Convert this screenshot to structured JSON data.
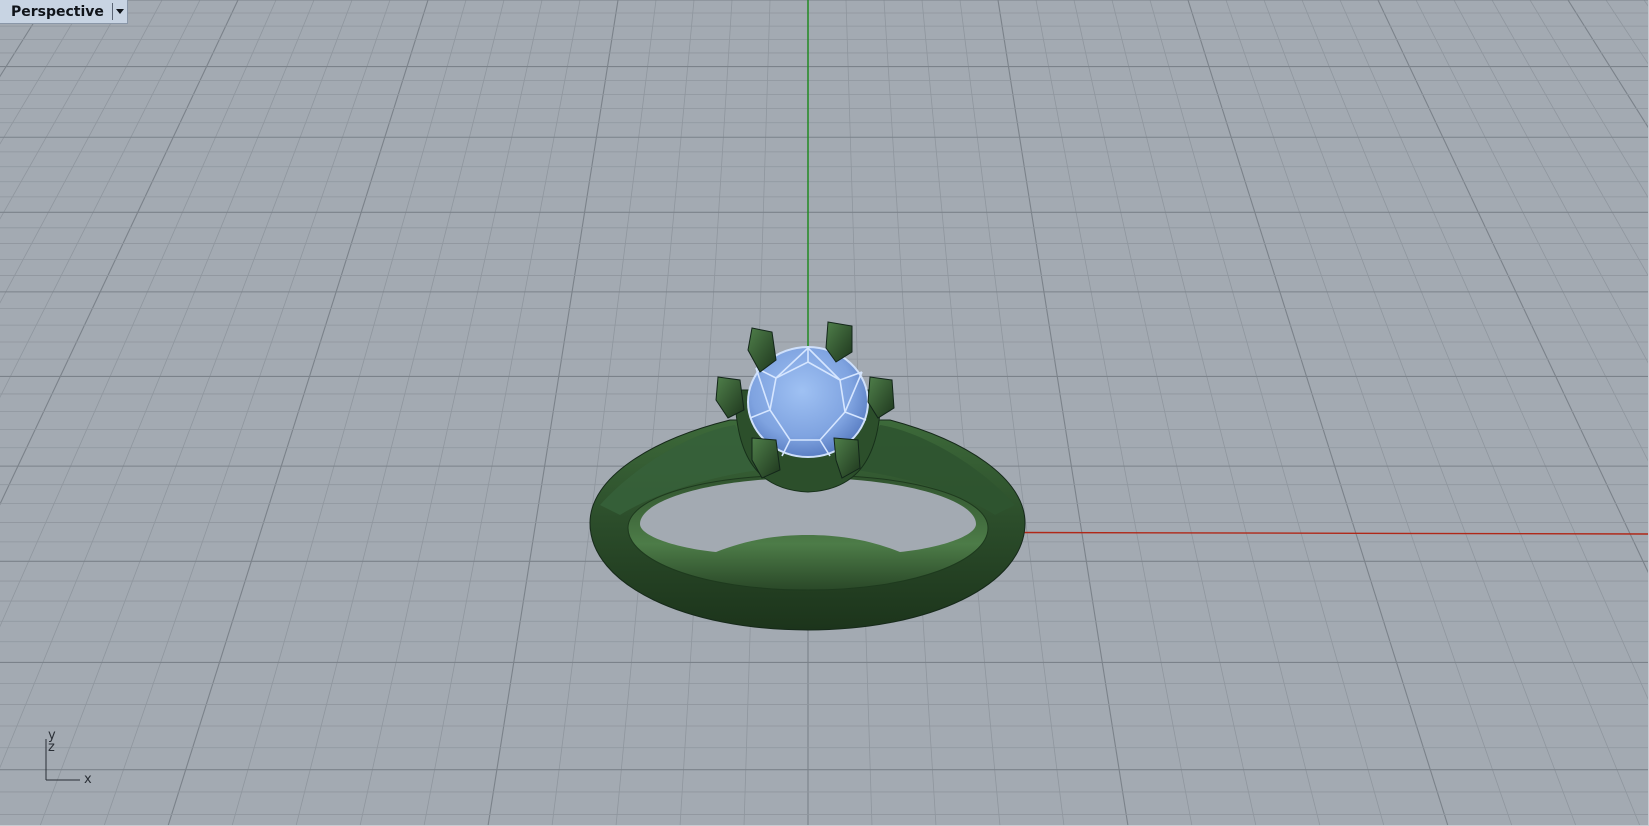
{
  "viewport": {
    "title": "Perspective",
    "dropdown_icon": "triangle-down-icon"
  },
  "axes": {
    "y_label": "y",
    "z_label": "z",
    "x_label": "x"
  },
  "colors": {
    "background": "#a3aab2",
    "grid_minor": "#8f969e",
    "grid_major": "#7b828a",
    "x_axis": "#b02818",
    "y_axis": "#1a8a1a",
    "ring_metal": "#2b4c2a",
    "gem": "#8fb2ea"
  },
  "scene": {
    "objects": [
      "ring-band",
      "prong-setting",
      "round-gemstone"
    ]
  }
}
